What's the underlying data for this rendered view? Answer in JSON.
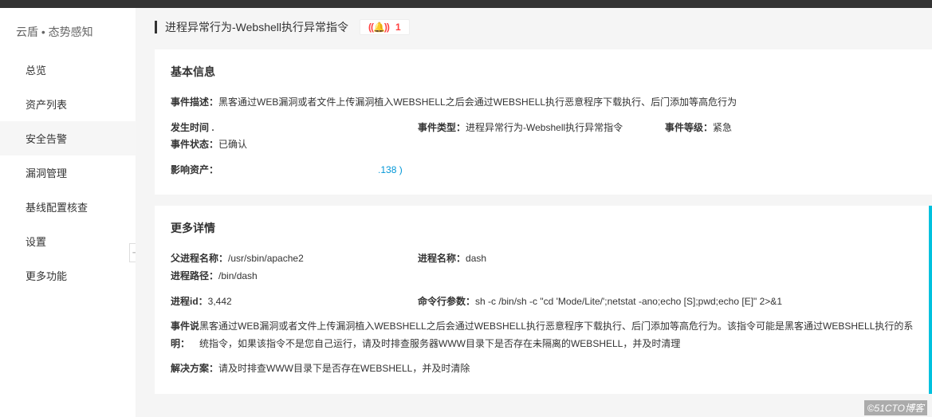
{
  "brand": "云盾 • 态势感知",
  "nav": {
    "items": [
      {
        "label": "总览"
      },
      {
        "label": "资产列表"
      },
      {
        "label": "安全告警"
      },
      {
        "label": "漏洞管理"
      },
      {
        "label": "基线配置核查"
      },
      {
        "label": "设置"
      },
      {
        "label": "更多功能"
      }
    ],
    "active_index": 2
  },
  "page_title": "进程异常行为-Webshell执行异常指令",
  "notification_count": "1",
  "basic_info": {
    "section_title": "基本信息",
    "desc_label": "事件描述：",
    "desc_value": "黑客通过WEB漏洞或者文件上传漏洞植入WEBSHELL之后会通过WEBSHELL执行恶意程序下载执行、后门添加等高危行为",
    "time_label": "发生时间 .",
    "type_label": "事件类型：",
    "type_value": "进程异常行为-Webshell执行异常指令",
    "level_label": "事件等级：",
    "level_value": "紧急",
    "status_label": "事件状态：",
    "status_value": "已确认",
    "asset_label": "影响资产：",
    "asset_value_suffix": ".138 )"
  },
  "more_details": {
    "section_title": "更多详情",
    "parent_proc_label": "父进程名称：",
    "parent_proc_value": "/usr/sbin/apache2",
    "proc_name_label": "进程名称：",
    "proc_name_value": "dash",
    "proc_path_label": "进程路径：",
    "proc_path_value": "/bin/dash",
    "pid_label": "进程id：",
    "pid_value": "3,442",
    "cmd_label": "命令行参数：",
    "cmd_value": "sh -c /bin/sh -c \"cd 'Mode/Lite/';netstat -ano;echo [S];pwd;echo [E]\" 2>&1",
    "explain_label": "事件说明：",
    "explain_value": "黑客通过WEB漏洞或者文件上传漏洞植入WEBSHELL之后会通过WEBSHELL执行恶意程序下载执行、后门添加等高危行为。该指令可能是黑客通过WEBSHELL执行的系统指令，如果该指令不是您自己运行，请及时排查服务器WWW目录下是否存在未隔离的WEBSHELL，并及时清理",
    "solution_label": "解决方案：",
    "solution_value": "请及时排查WWW目录下是否存在WEBSHELL，并及时清除"
  },
  "watermark": "©51CTO博客"
}
